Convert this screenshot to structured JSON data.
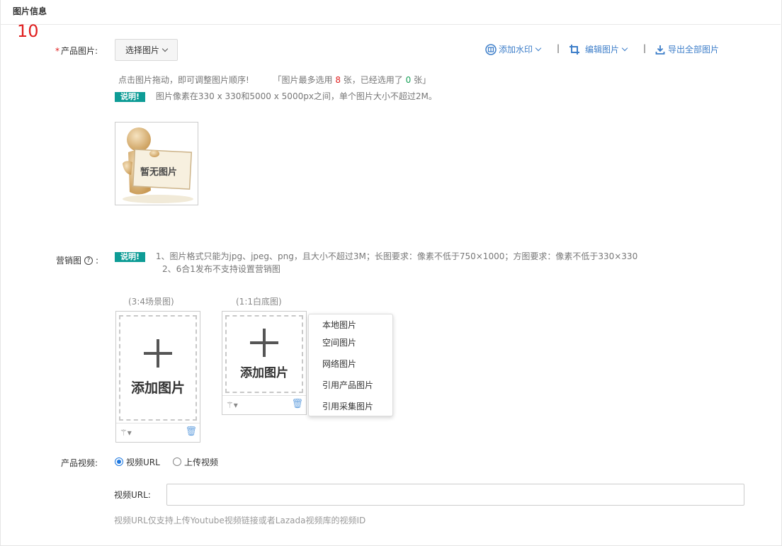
{
  "section": {
    "title": "图片信息",
    "number": "10"
  },
  "product_images": {
    "label": "产品图片:",
    "required_mark": "*",
    "select_button": "选择图片",
    "tools": {
      "watermark": "添加水印",
      "edit": "编辑图片",
      "export": "导出全部图片",
      "separator": "|"
    },
    "hint_drag": "点击图片拖动，即可调整图片顺序!",
    "hint_count_prefix": "「图片最多选用",
    "hint_max": "8",
    "hint_mid": "张，已经选用了",
    "hint_used": "0",
    "hint_suffix": "张」",
    "note_tag": "说明!",
    "note_text": "图片像素在330 x 330和5000 x 5000px之间，单个图片大小不超过2M。",
    "placeholder_text": "暂无图片"
  },
  "marketing": {
    "label": "营销图",
    "colon": ":",
    "note_tag": "说明!",
    "note_line1": "1、图片格式只能为jpg、jpeg、png，且大小不超过3M；长图要求：像素不低于750×1000；方图要求：像素不低于330×330",
    "note_line2": "2、6合1发布不支持设置营销图",
    "slot1_caption": "(3:4场景图)",
    "slot2_caption": "(1:1白底图)",
    "add_text": "添加图片",
    "menu": [
      "本地图片",
      "空间图片",
      "网络图片",
      "引用产品图片",
      "引用采集图片"
    ]
  },
  "video": {
    "label": "产品视频:",
    "option_url": "视频URL",
    "option_upload": "上传视频",
    "url_label": "视频URL:",
    "url_value": "",
    "hint": "视频URL仅支持上传Youtube视频链接或者Lazada视频库的视频ID"
  },
  "colors": {
    "accent": "#3d7ec9",
    "tag": "#0e9c96",
    "required": "#e02020",
    "radio": "#1e78e0"
  }
}
